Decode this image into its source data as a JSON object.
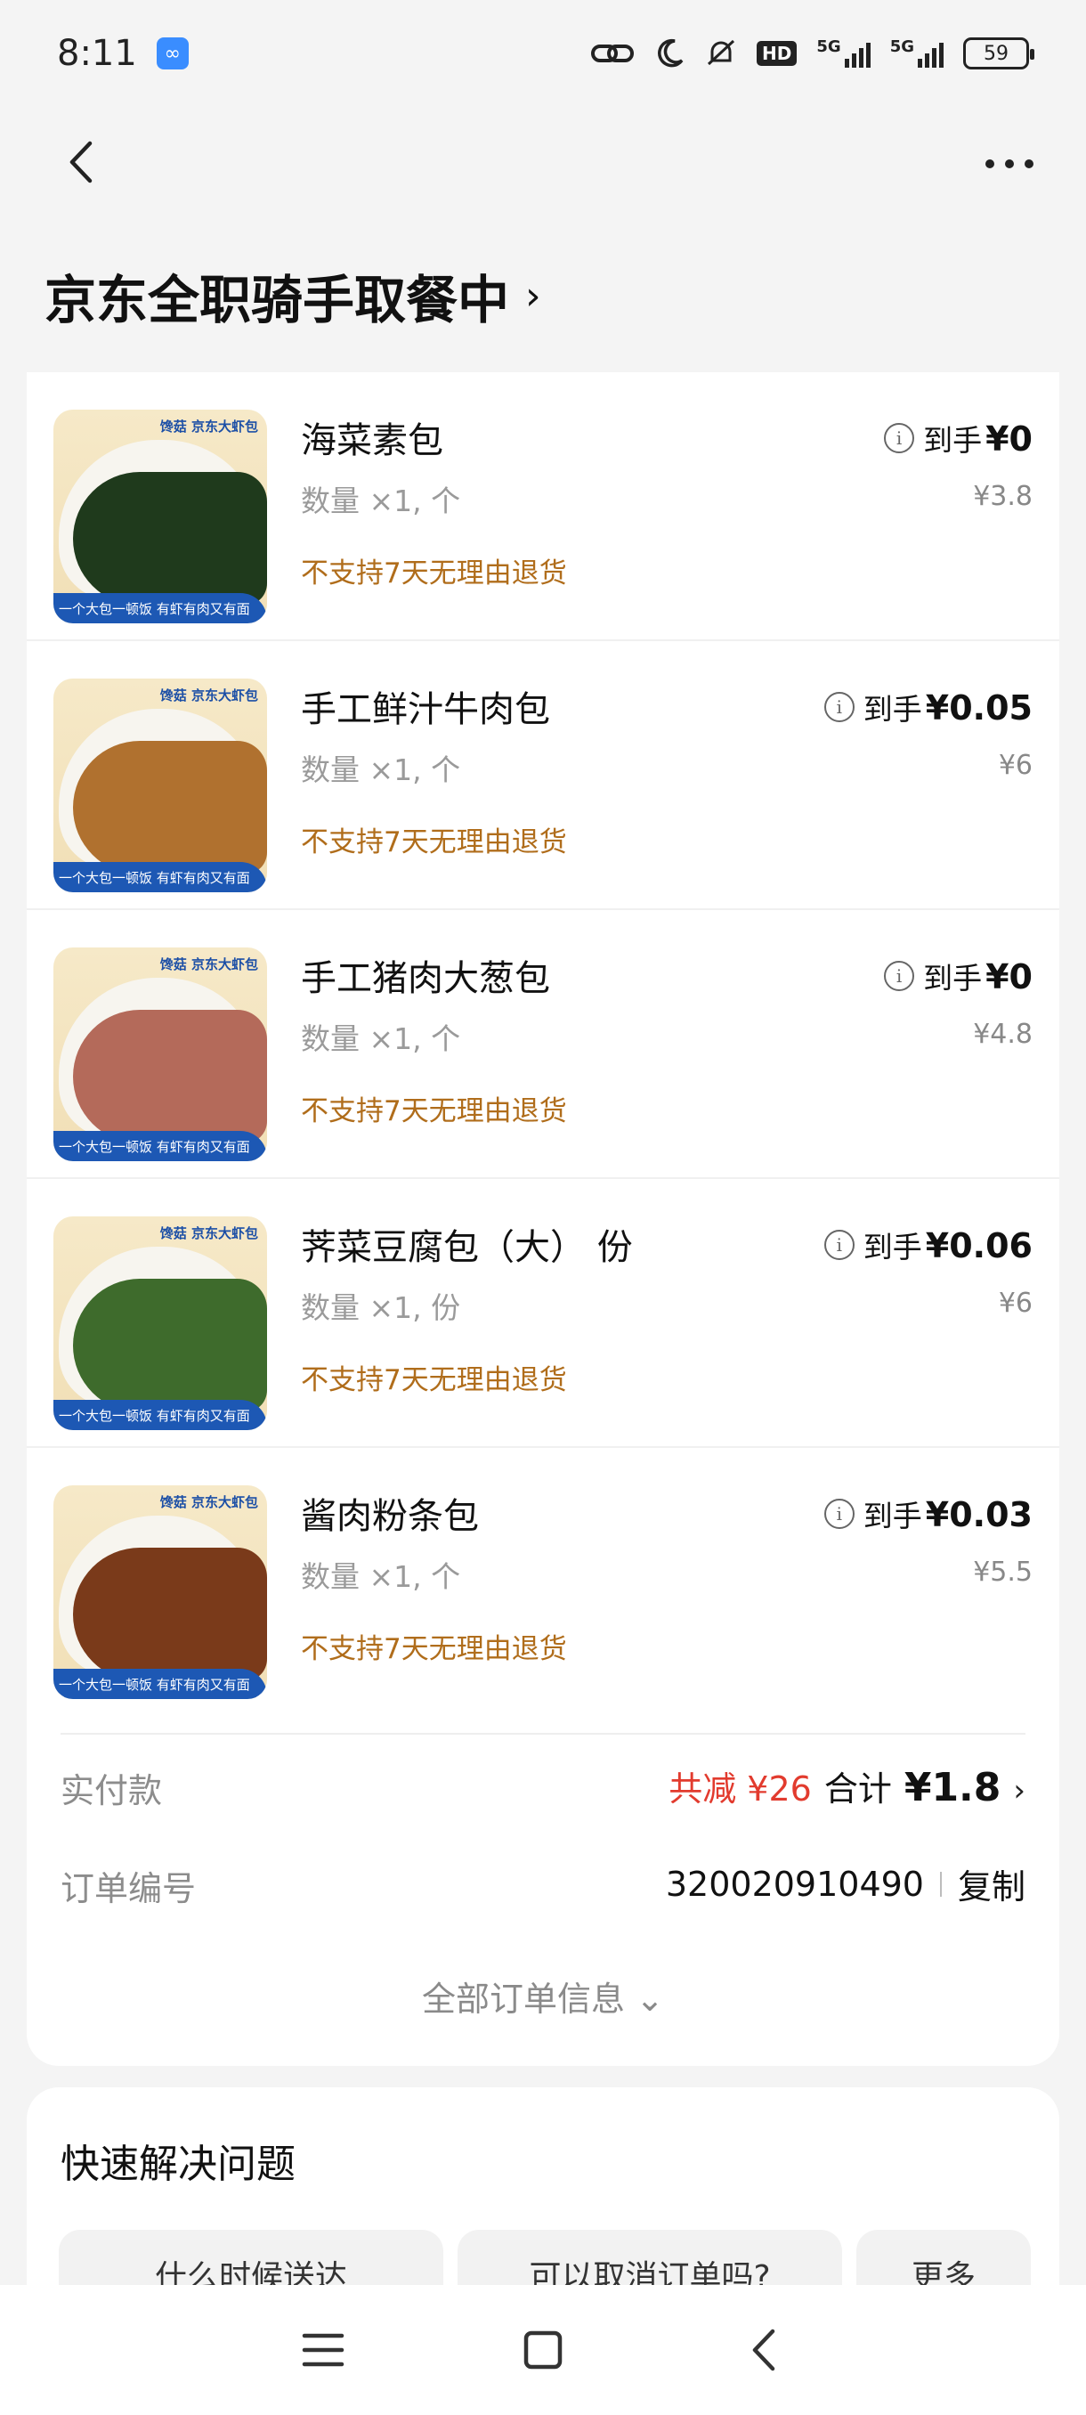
{
  "status_bar": {
    "time": "8:11",
    "signal_label_1": "5G",
    "signal_label_2": "5G",
    "hd": "HD",
    "battery": "59"
  },
  "header": {
    "title": "京东全职骑手取餐中",
    "title_chevron": "›"
  },
  "items": [
    {
      "name": "海菜素包",
      "qty": "数量 ×1, 个",
      "policy": "不支持7天无理由退货",
      "price_prefix": "到手",
      "price": "¥0",
      "orig": "¥3.8",
      "filling_color": "#1f3a1c"
    },
    {
      "name": "手工鲜汁牛肉包",
      "qty": "数量 ×1, 个",
      "policy": "不支持7天无理由退货",
      "price_prefix": "到手",
      "price": "¥0.05",
      "orig": "¥6",
      "filling_color": "#b0712f"
    },
    {
      "name": "手工猪肉大葱包",
      "qty": "数量 ×1, 个",
      "policy": "不支持7天无理由退货",
      "price_prefix": "到手",
      "price": "¥0",
      "orig": "¥4.8",
      "filling_color": "#b46a5a"
    },
    {
      "name": "荠菜豆腐包（大） 份",
      "qty": "数量 ×1, 份",
      "policy": "不支持7天无理由退货",
      "price_prefix": "到手",
      "price": "¥0.06",
      "orig": "¥6",
      "filling_color": "#3e6b2c"
    },
    {
      "name": "酱肉粉条包",
      "qty": "数量 ×1, 个",
      "policy": "不支持7天无理由退货",
      "price_prefix": "到手",
      "price": "¥0.03",
      "orig": "¥5.5",
      "filling_color": "#7a3a1a"
    }
  ],
  "thumb": {
    "brand": "馋菇 京东大虾包",
    "banner": "一个大包一顿饭 有虾有肉又有面"
  },
  "payment": {
    "label": "实付款",
    "discount": "共减 ¥26",
    "total_label": "合计",
    "total": "¥1.8",
    "chevron": "›"
  },
  "order": {
    "label": "订单编号",
    "number": "320020910490",
    "copy": "复制"
  },
  "all_info": "全部订单信息 ⌄",
  "quick": {
    "title": "快速解决问题",
    "chips": [
      "什么时候送达",
      "可以取消订单吗?",
      "更多"
    ]
  }
}
